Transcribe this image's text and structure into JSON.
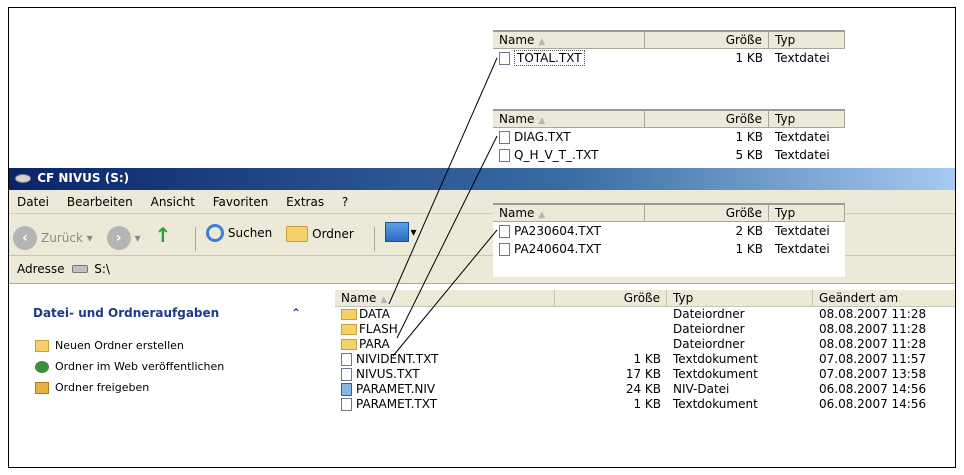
{
  "window": {
    "title": "CF NIVUS (S:)"
  },
  "menu": [
    "Datei",
    "Bearbeiten",
    "Ansicht",
    "Favoriten",
    "Extras",
    "?"
  ],
  "toolbar": {
    "back": "Zurück",
    "search": "Suchen",
    "folders": "Ordner"
  },
  "address": {
    "label": "Adresse",
    "value": "S:\\"
  },
  "taskpane": {
    "title": "Datei- und Ordneraufgaben",
    "collapse": "⌃",
    "items": [
      "Neuen Ordner erstellen",
      "Ordner im Web veröffentlichen",
      "Ordner freigeben"
    ]
  },
  "filelist": {
    "columns": [
      "Name",
      "Größe",
      "Typ",
      "Geändert am"
    ],
    "rows": [
      {
        "name": "DATA",
        "size": "",
        "type": "Dateiordner",
        "date": "08.08.2007 11:28",
        "icon": "folder"
      },
      {
        "name": "FLASH",
        "size": "",
        "type": "Dateiordner",
        "date": "08.08.2007 11:28",
        "icon": "folder"
      },
      {
        "name": "PARA",
        "size": "",
        "type": "Dateiordner",
        "date": "08.08.2007 11:28",
        "icon": "folder"
      },
      {
        "name": "NIVIDENT.TXT",
        "size": "1 KB",
        "type": "Textdokument",
        "date": "07.08.2007 11:57",
        "icon": "txt"
      },
      {
        "name": "NIVUS.TXT",
        "size": "17 KB",
        "type": "Textdokument",
        "date": "07.08.2007 13:58",
        "icon": "txt"
      },
      {
        "name": "PARAMET.NIV",
        "size": "24 KB",
        "type": "NIV-Datei",
        "date": "06.08.2007 14:56",
        "icon": "niv"
      },
      {
        "name": "PARAMET.TXT",
        "size": "1 KB",
        "type": "Textdokument",
        "date": "06.08.2007 14:56",
        "icon": "txt"
      }
    ]
  },
  "overlays": [
    {
      "columns": [
        "Name",
        "Größe",
        "Typ"
      ],
      "rows": [
        {
          "name": "TOTAL.TXT",
          "size": "1 KB",
          "type": "Textdatei"
        }
      ]
    },
    {
      "columns": [
        "Name",
        "Größe",
        "Typ"
      ],
      "rows": [
        {
          "name": "DIAG.TXT",
          "size": "1 KB",
          "type": "Textdatei"
        },
        {
          "name": "Q_H_V_T_.TXT",
          "size": "5 KB",
          "type": "Textdatei"
        }
      ]
    },
    {
      "columns": [
        "Name",
        "Größe",
        "Typ"
      ],
      "rows": [
        {
          "name": "PA230604.TXT",
          "size": "2 KB",
          "type": "Textdatei"
        },
        {
          "name": "PA240604.TXT",
          "size": "1 KB",
          "type": "Textdatei"
        }
      ]
    }
  ]
}
